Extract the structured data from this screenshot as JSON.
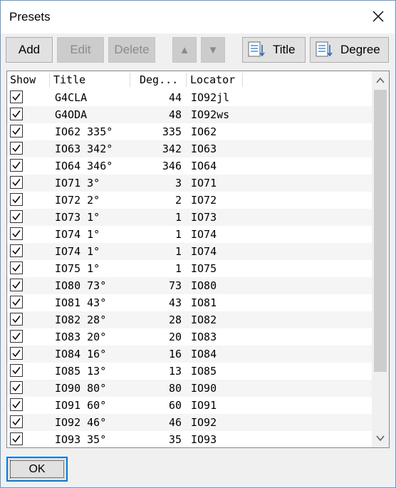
{
  "dialog": {
    "title": "Presets"
  },
  "toolbar": {
    "add_label": "Add",
    "edit_label": "Edit",
    "delete_label": "Delete",
    "move_up_label": "▲",
    "move_down_label": "▼",
    "sort_title_label": "Title",
    "sort_degree_label": "Degree"
  },
  "list": {
    "headers": {
      "show": "Show",
      "title": "Title",
      "degree": "Deg...",
      "locator": "Locator"
    },
    "rows": [
      {
        "checked": true,
        "title": "G4CLA",
        "degree": "44",
        "locator": "IO92jl"
      },
      {
        "checked": true,
        "title": "G4ODA",
        "degree": "48",
        "locator": "IO92ws"
      },
      {
        "checked": true,
        "title": "IO62 335°",
        "degree": "335",
        "locator": "IO62"
      },
      {
        "checked": true,
        "title": "IO63 342°",
        "degree": "342",
        "locator": "IO63"
      },
      {
        "checked": true,
        "title": "IO64 346°",
        "degree": "346",
        "locator": "IO64"
      },
      {
        "checked": true,
        "title": "IO71 3°",
        "degree": "3",
        "locator": "IO71"
      },
      {
        "checked": true,
        "title": "IO72 2°",
        "degree": "2",
        "locator": "IO72"
      },
      {
        "checked": true,
        "title": "IO73 1°",
        "degree": "1",
        "locator": "IO73"
      },
      {
        "checked": true,
        "title": "IO74 1°",
        "degree": "1",
        "locator": "IO74"
      },
      {
        "checked": true,
        "title": "IO74 1°",
        "degree": "1",
        "locator": "IO74"
      },
      {
        "checked": true,
        "title": "IO75 1°",
        "degree": "1",
        "locator": "IO75"
      },
      {
        "checked": true,
        "title": "IO80 73°",
        "degree": "73",
        "locator": "IO80"
      },
      {
        "checked": true,
        "title": "IO81 43°",
        "degree": "43",
        "locator": "IO81"
      },
      {
        "checked": true,
        "title": "IO82 28°",
        "degree": "28",
        "locator": "IO82"
      },
      {
        "checked": true,
        "title": "IO83 20°",
        "degree": "20",
        "locator": "IO83"
      },
      {
        "checked": true,
        "title": "IO84 16°",
        "degree": "16",
        "locator": "IO84"
      },
      {
        "checked": true,
        "title": "IO85 13°",
        "degree": "13",
        "locator": "IO85"
      },
      {
        "checked": true,
        "title": "IO90 80°",
        "degree": "80",
        "locator": "IO90"
      },
      {
        "checked": true,
        "title": "IO91 60°",
        "degree": "60",
        "locator": "IO91"
      },
      {
        "checked": true,
        "title": "IO92 46°",
        "degree": "46",
        "locator": "IO92"
      },
      {
        "checked": true,
        "title": "IO93 35°",
        "degree": "35",
        "locator": "IO93"
      }
    ]
  },
  "footer": {
    "ok_label": "OK"
  }
}
